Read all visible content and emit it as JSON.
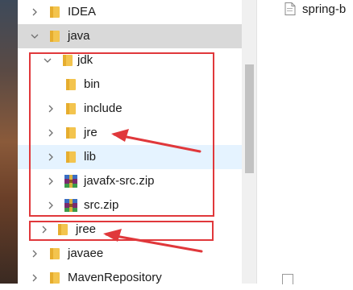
{
  "tree": {
    "items": [
      {
        "label": "IDEA",
        "icon": "folder-icon",
        "expander": "chevron-right-icon"
      },
      {
        "label": "java",
        "icon": "folder-icon",
        "expander": "chevron-down-icon",
        "state": "selected"
      },
      {
        "label": "jdk",
        "icon": "folder-icon",
        "expander": "chevron-down-icon"
      },
      {
        "label": "bin",
        "icon": "folder-icon"
      },
      {
        "label": "include",
        "icon": "folder-icon",
        "expander": "chevron-right-icon"
      },
      {
        "label": "jre",
        "icon": "folder-icon",
        "expander": "chevron-right-icon"
      },
      {
        "label": "lib",
        "icon": "folder-icon",
        "expander": "chevron-right-icon",
        "state": "hover"
      },
      {
        "label": "javafx-src.zip",
        "icon": "zip-archive-icon",
        "expander": "chevron-right-icon"
      },
      {
        "label": "src.zip",
        "icon": "zip-archive-icon",
        "expander": "chevron-right-icon"
      },
      {
        "label": "jree",
        "icon": "folder-icon",
        "expander": "chevron-right-icon"
      },
      {
        "label": "javaee",
        "icon": "folder-icon",
        "expander": "chevron-right-icon"
      },
      {
        "label": "MavenRepository",
        "icon": "folder-icon",
        "expander": "chevron-right-icon"
      }
    ]
  },
  "right_pane": {
    "file_label": "spring-b",
    "file_icon": "document-icon"
  },
  "annotations": {
    "color": "#e0383b",
    "boxes": [
      "jdk-contents-box",
      "jree-box"
    ],
    "arrows": [
      "arrow-to-jre",
      "arrow-to-jree"
    ]
  },
  "colors": {
    "selected_row": "#d9d9d9",
    "hover_row": "#e5f3ff",
    "folder": "#f3c44e"
  }
}
